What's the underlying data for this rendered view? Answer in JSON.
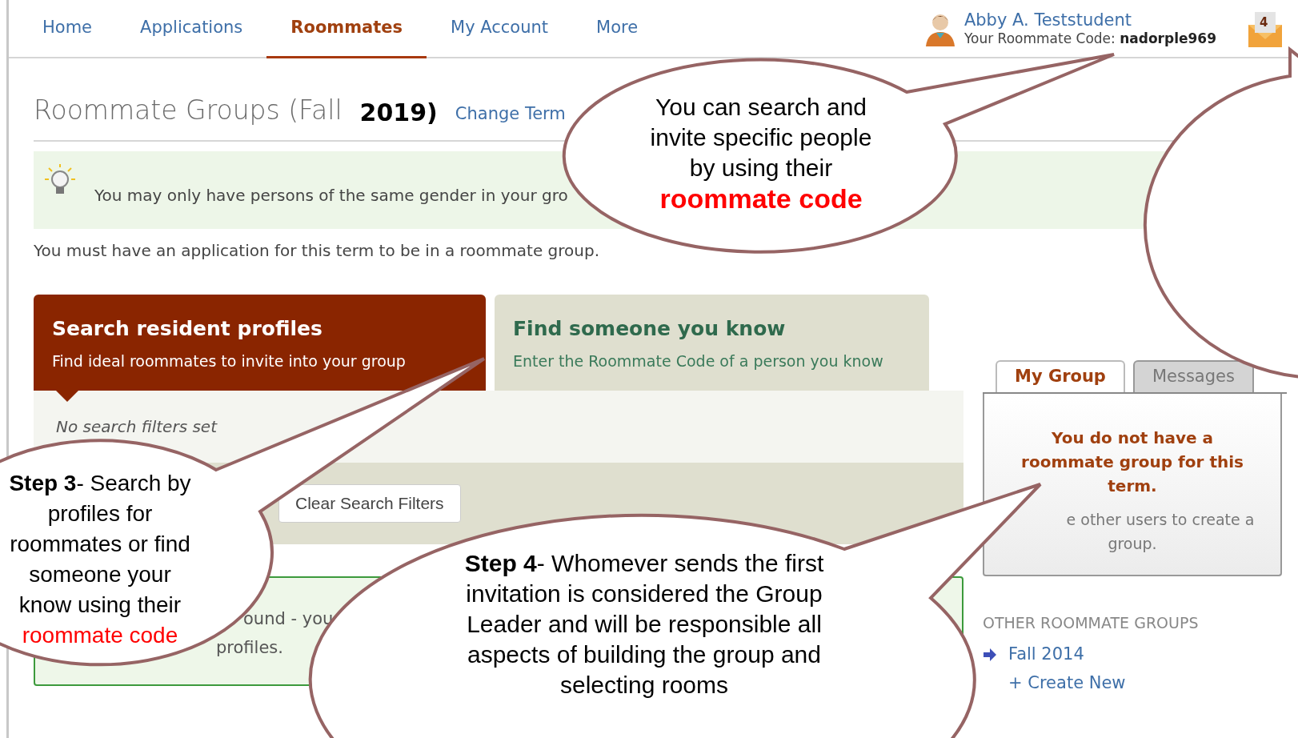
{
  "nav": {
    "tabs": [
      {
        "label": "Home",
        "selected": false
      },
      {
        "label": "Applications",
        "selected": false
      },
      {
        "label": "Roommates",
        "selected": true
      },
      {
        "label": "My Account",
        "selected": false
      },
      {
        "label": "More",
        "selected": false
      }
    ],
    "user": {
      "name": "Abby A. Teststudent",
      "code_label": "Your Roommate Code:",
      "code": "nadorple969"
    },
    "mail_count": "4"
  },
  "header": {
    "title": "Roommate Groups (Fall",
    "title_year": "2019)",
    "change_term": "Change Term"
  },
  "tip": "You may only have persons of the same gender in your gro",
  "notice": "You must have an application for this term to be in a roommate group.",
  "cards": [
    {
      "title": "Search resident profiles",
      "subtitle": "Find ideal roommates to invite into your group",
      "selected": true
    },
    {
      "title": "Find someone you know",
      "subtitle": "Enter the Roommate Code of a person you know",
      "selected": false
    }
  ],
  "filters": {
    "status": "No search filters set",
    "clear_button": "Clear Search Filters"
  },
  "result_fragments": [
    "ound - you",
    "profiles."
  ],
  "side_panel": {
    "tabs": [
      {
        "label": "My Group",
        "selected": true
      },
      {
        "label": "Messages",
        "selected": false
      }
    ],
    "message": "You do not have a roommate group for this term.",
    "hint_lines": [
      "e other users to create a",
      "group."
    ],
    "other_heading": "OTHER ROOMMATE GROUPS",
    "links": [
      {
        "label": "Fall 2014",
        "kind": "term"
      },
      {
        "label": "+ Create New",
        "kind": "create"
      }
    ]
  },
  "callouts": [
    {
      "text": "You can search and invite specific people by using their",
      "highlight": "roommate code",
      "bold_highlight": true
    },
    {
      "text": "**Step 3**- Search by profiles for roommates or find someone your know using their",
      "highlight": "roommate code",
      "bold_highlight": false
    },
    {
      "text": "**Step 4**- Whomever sends the first invitation is considered the Group Leader and will be responsible all aspects of building the group and selecting rooms"
    }
  ]
}
